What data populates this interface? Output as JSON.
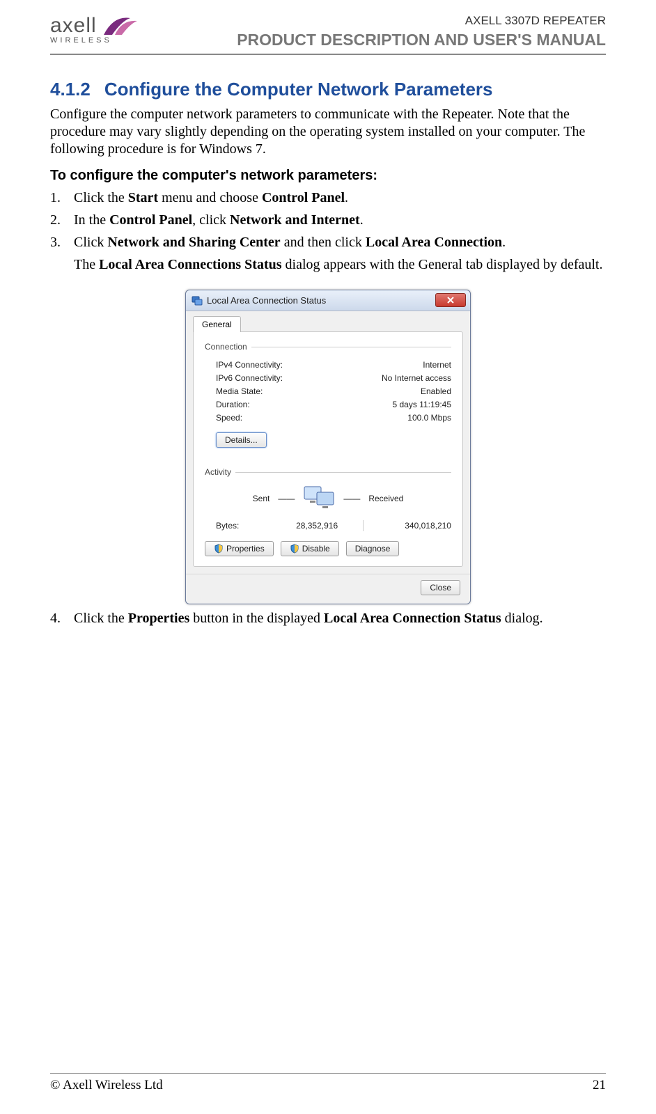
{
  "header": {
    "brand": "axell",
    "brand_sub": "WIRELESS",
    "product_line": "AXELL 3307D REPEATER",
    "manual_line": "PRODUCT DESCRIPTION AND USER'S MANUAL"
  },
  "section": {
    "number": "4.1.2",
    "title": "Configure the Computer Network Parameters"
  },
  "intro": "Configure the computer network parameters to communicate with the Repeater. Note that the procedure may vary slightly depending on the operating system installed on your computer. The following procedure is for Windows 7.",
  "sub_heading": "To configure the computer's network parameters:",
  "steps": [
    {
      "n": "1.",
      "pre": "Click the ",
      "b1": "Start",
      "mid": " menu and choose ",
      "b2": "Control Panel",
      "post": "."
    },
    {
      "n": "2.",
      "pre": "In the ",
      "b1": "Control Panel",
      "mid": ", click ",
      "b2": "Network and Internet",
      "post": "."
    },
    {
      "n": "3.",
      "pre": "Click ",
      "b1": "Network and Sharing Center",
      "mid": " and then click ",
      "b2": "Local Area Connection",
      "post": "."
    }
  ],
  "step3_follow": {
    "pre": "The ",
    "b": "Local Area Connections Status",
    "post": " dialog appears with the General tab displayed by default."
  },
  "step4": {
    "n": "4.",
    "pre": "Click the ",
    "b1": "Properties",
    "mid": " button in the displayed ",
    "b2": "Local Area Connection Status",
    "post": " dialog."
  },
  "dialog": {
    "title": "Local Area Connection Status",
    "tab": "General",
    "conn_label": "Connection",
    "rows": {
      "ipv4_k": "IPv4 Connectivity:",
      "ipv4_v": "Internet",
      "ipv6_k": "IPv6 Connectivity:",
      "ipv6_v": "No Internet access",
      "media_k": "Media State:",
      "media_v": "Enabled",
      "dur_k": "Duration:",
      "dur_v": "5 days 11:19:45",
      "speed_k": "Speed:",
      "speed_v": "100.0 Mbps"
    },
    "details_btn": "Details...",
    "activity_label": "Activity",
    "sent": "Sent",
    "received": "Received",
    "bytes_label": "Bytes:",
    "bytes_sent": "28,352,916",
    "bytes_recv": "340,018,210",
    "properties_btn": "Properties",
    "disable_btn": "Disable",
    "diagnose_btn": "Diagnose",
    "close_btn": "Close"
  },
  "footer": {
    "copyright": "© Axell Wireless Ltd",
    "page": "21"
  }
}
